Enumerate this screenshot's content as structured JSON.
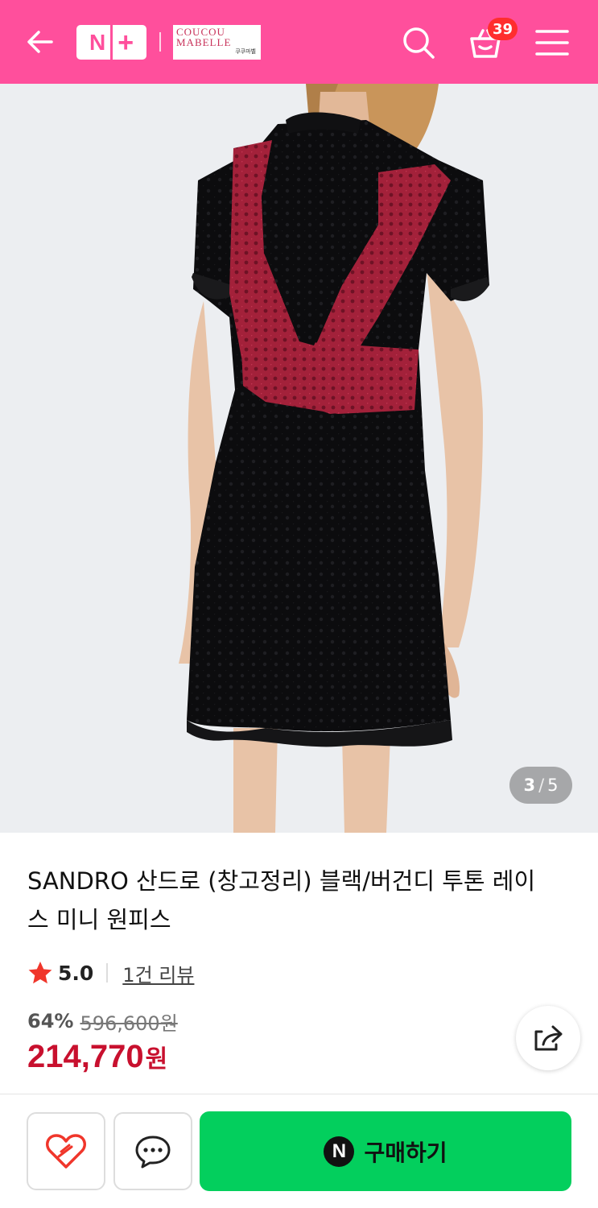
{
  "header": {
    "background": "#ff4f9c",
    "back_icon": "arrow-left-icon",
    "nplus_logo": {
      "n": "N",
      "plus": "+"
    },
    "store_logo": {
      "line1": "COUCOU",
      "line2": "MABELLE",
      "sub": "쿠쿠마벨"
    },
    "search_icon": "search-icon",
    "cart_icon": "shopping-bag-icon",
    "cart_count": "39",
    "menu_icon": "hamburger-menu-icon"
  },
  "gallery": {
    "image_alt": "black and burgundy lace mini dress, back view",
    "current": "3",
    "separator": "/",
    "total": "5"
  },
  "product": {
    "title": "SANDRO 산드로 (창고정리) 블랙/버건디 투톤 레이스 미니 원피스",
    "rating": "5.0",
    "review_link": "1건 리뷰",
    "discount": "64%",
    "original_price": "596,600원",
    "sale_price": "214,770",
    "sale_unit": "원",
    "sale_color": "#c8102e"
  },
  "actions": {
    "share_icon": "share-icon",
    "wishlist_icon": "heart-icon",
    "talk_icon": "chat-bubble-icon",
    "buy_badge": "N",
    "buy_label": "구매하기",
    "buy_color": "#03cf5d"
  }
}
